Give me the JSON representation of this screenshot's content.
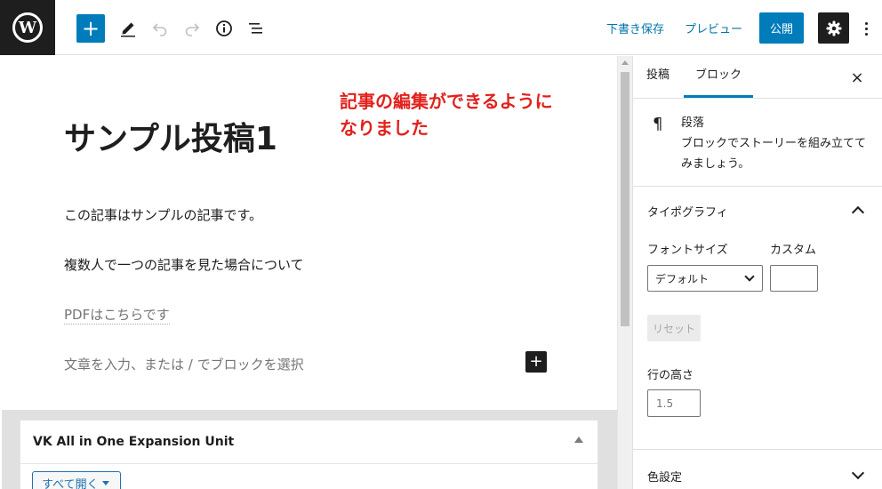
{
  "toolbar": {
    "logo_letter": "W",
    "add_label": "+",
    "save_draft": "下書き保存",
    "preview": "プレビュー",
    "publish": "公開"
  },
  "editor": {
    "title": "サンプル投稿1",
    "annotation_line1": "記事の編集ができるように",
    "annotation_line2": "なりました",
    "paragraphs": [
      "この記事はサンプルの記事です。",
      "複数人で一つの記事を見た場合について",
      "PDFはこちらです"
    ],
    "placeholder": "文章を入力、または / でブロックを選択",
    "inline_add": "+"
  },
  "metabox": {
    "title": "VK All in One Expansion Unit",
    "expand_label": "すべて開く"
  },
  "sidebar": {
    "tabs": [
      "投稿",
      "ブロック"
    ],
    "active_tab": "ブロック",
    "close": "×",
    "block": {
      "icon": "¶",
      "name": "段落",
      "description": "ブロックでストーリーを組み立ててみましょう。"
    },
    "typography": {
      "title": "タイポグラフィ",
      "font_size_label": "フォントサイズ",
      "custom_label": "カスタム",
      "font_size_value": "デフォルト",
      "custom_value": "",
      "reset": "リセット",
      "line_height_label": "行の高さ",
      "line_height_placeholder": "1.5"
    },
    "color": {
      "title": "色設定"
    }
  },
  "colors": {
    "accent": "#007cba",
    "annotation": "#e2211c",
    "dark": "#1e1e1e"
  }
}
